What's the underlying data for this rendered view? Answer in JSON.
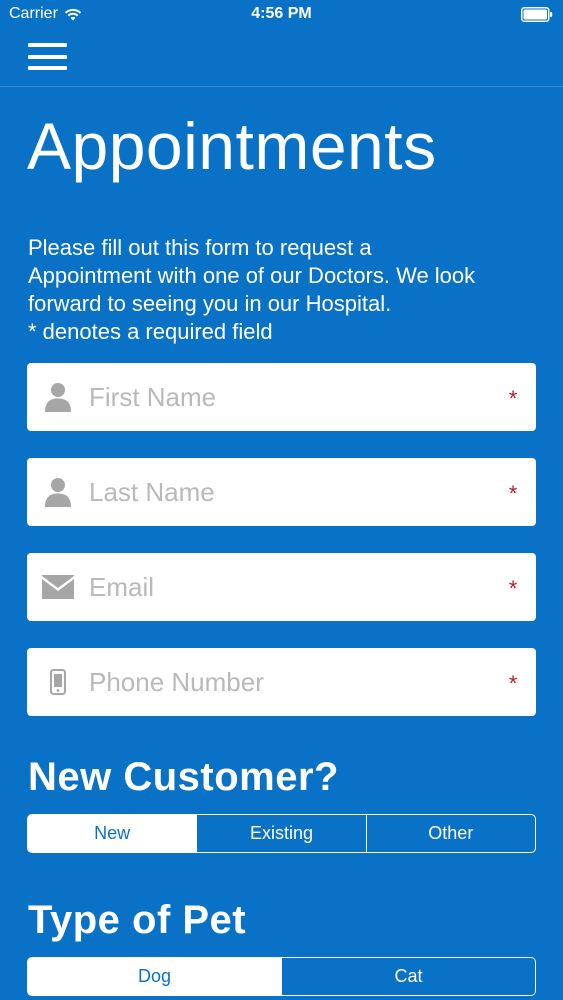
{
  "status_bar": {
    "carrier": "Carrier",
    "time": "4:56 PM",
    "icons": [
      "wifi-icon",
      "battery-icon"
    ]
  },
  "header": {
    "menu_icon": "hamburger-menu-icon"
  },
  "page": {
    "title": "Appointments",
    "intro_lines": [
      "Please fill out this form to request a",
      "Appointment with one of our Doctors. We look",
      "forward to seeing you in our Hospital.",
      "* denotes a required field"
    ]
  },
  "form": {
    "fields": [
      {
        "placeholder": "First Name",
        "value": "",
        "icon": "person-icon",
        "required_mark": "*"
      },
      {
        "placeholder": "Last Name",
        "value": "",
        "icon": "person-icon",
        "required_mark": "*"
      },
      {
        "placeholder": "Email",
        "value": "",
        "icon": "envelope-icon",
        "required_mark": "*"
      },
      {
        "placeholder": "Phone Number",
        "value": "",
        "icon": "mobile-phone-icon",
        "required_mark": "*"
      }
    ],
    "new_customer": {
      "title": "New Customer?",
      "options": [
        "New",
        "Existing",
        "Other"
      ],
      "selected": "New"
    },
    "pet_type": {
      "title": "Type of Pet",
      "options": [
        "Dog",
        "Cat"
      ],
      "selected": "Dog"
    }
  },
  "colors": {
    "background": "#0a72c6",
    "text": "#ffffff",
    "placeholder": "#b9b9b9",
    "icon_gray": "#a6a6a6",
    "required": "#c0192a"
  }
}
